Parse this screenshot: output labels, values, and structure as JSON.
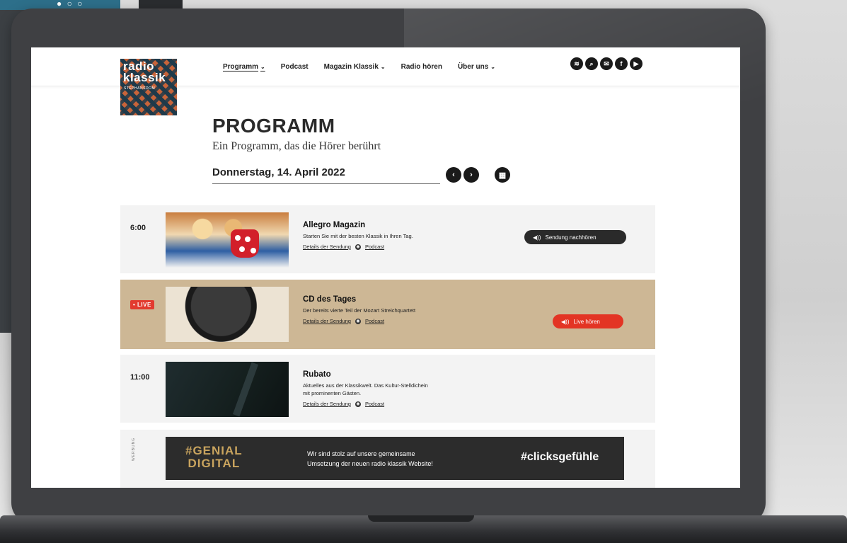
{
  "nav": {
    "items": [
      {
        "label": "Programm",
        "dropdown": true,
        "active": true
      },
      {
        "label": "Podcast",
        "dropdown": false
      },
      {
        "label": "Magazin Klassik",
        "dropdown": true
      },
      {
        "label": "Radio hören",
        "dropdown": false
      },
      {
        "label": "Über uns",
        "dropdown": true
      }
    ],
    "chevron": "⌄"
  },
  "logo": {
    "line1": "radio",
    "line2": "klassik",
    "sub": "STEPHANSDOM"
  },
  "social": [
    {
      "icon": "spotify-icon",
      "glyph": "≋"
    },
    {
      "icon": "search-icon",
      "glyph": "⌕"
    },
    {
      "icon": "mail-icon",
      "glyph": "✉"
    },
    {
      "icon": "facebook-icon",
      "glyph": "f"
    },
    {
      "icon": "youtube-icon",
      "glyph": "▶"
    }
  ],
  "page": {
    "title": "PROGRAMM",
    "subtitle": "Ein Programm, das die Hörer berührt",
    "date": "Donnerstag, 14. April 2022",
    "prev_glyph": "‹",
    "next_glyph": "›",
    "calendar_glyph": "▦"
  },
  "schedule": [
    {
      "time": "6:00",
      "title": "Allegro Magazin",
      "desc": "Starten Sie mit der besten Klassik in Ihren Tag.",
      "details": "Details der Sendung",
      "podcast": "Podcast",
      "action": "Sendung nachhören"
    },
    {
      "live_badge": "• LIVE",
      "title": "CD des Tages",
      "desc": "Der bereits vierte Teil der Mozart Streichquartett",
      "details": "Details der Sendung",
      "podcast": "Podcast",
      "action": "Live hören"
    },
    {
      "time": "11:00",
      "title": "Rubato",
      "desc_line1": "Aktuelles aus der Klassikwelt. Das Kultur-Stelldichein",
      "desc_line2": "mit prominenten Gästen.",
      "details": "Details der Sendung",
      "podcast": "Podcast"
    }
  ],
  "ad": {
    "label": "WERBUNG",
    "tag_line1": "#GENIAL",
    "tag_line2": "DIGITAL",
    "text_line1": "Wir sind stolz auf unsere gemeinsame",
    "text_line2": "Umsetzung der neuen radio klassik Website!",
    "hashtag": "#clicksgefühle"
  },
  "speaker_glyph": "◀))",
  "globe_glyph": "◉",
  "colors": {
    "accent": "#e33424",
    "live_row": "#cdb795",
    "gold": "#c9a45e",
    "dark": "#1a1a1a"
  }
}
